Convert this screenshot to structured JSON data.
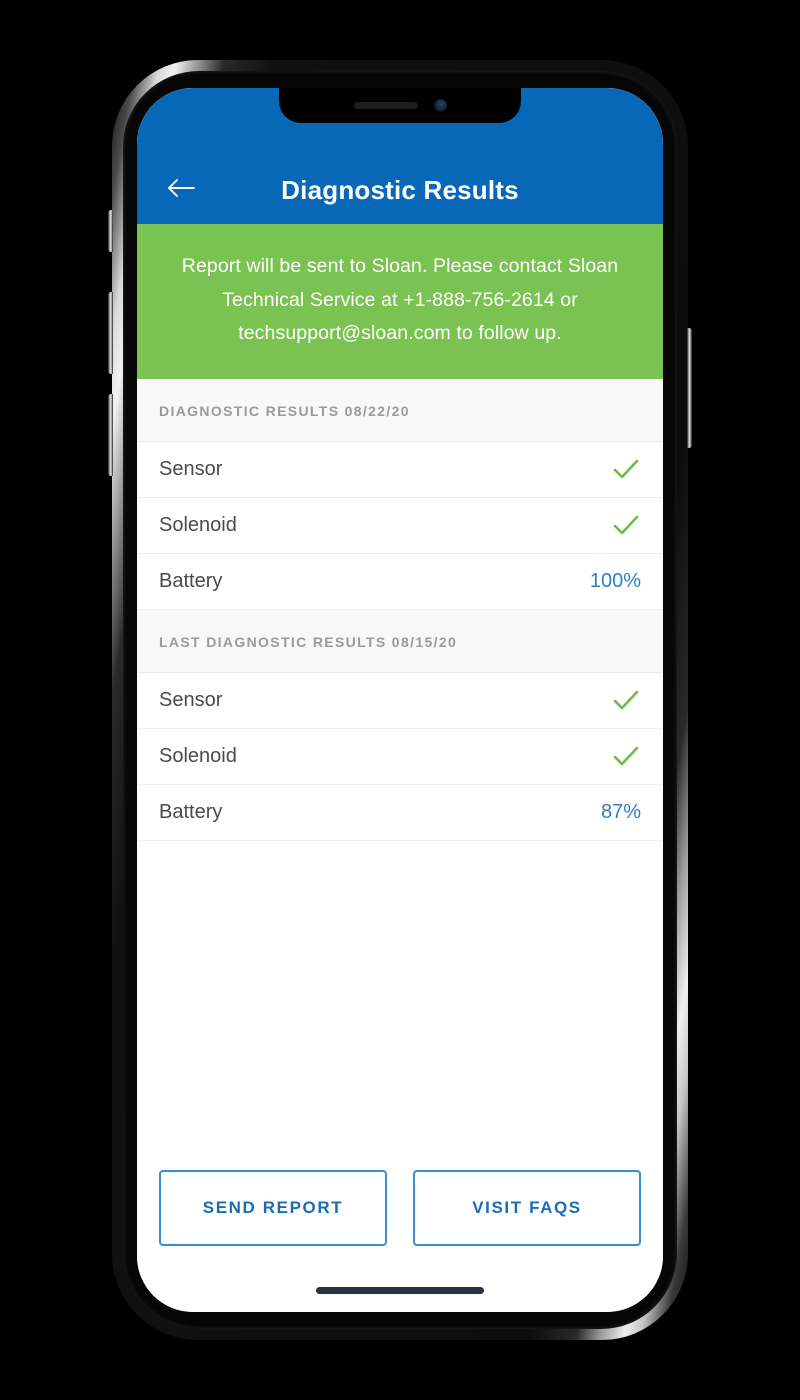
{
  "colors": {
    "brand_blue": "#0868b8",
    "banner_green": "#7ac352",
    "check_green": "#6cbe45",
    "value_blue": "#2e7fc4",
    "button_border": "#3b8fd0",
    "button_text": "#1a6cb5",
    "section_header_bg": "#f8f8f8",
    "section_header_text": "#9a9a9a",
    "row_text": "#4a4a4a"
  },
  "appbar": {
    "back_icon": "arrow-left-icon",
    "title": "Diagnostic Results"
  },
  "banner": {
    "text": "Report will be sent to Sloan. Please contact Sloan Technical Service at +1-888-756-2614 or techsupport@sloan.com to follow up."
  },
  "sections": [
    {
      "header": "DIAGNOSTIC RESULTS 08/22/20",
      "rows": [
        {
          "label": "Sensor",
          "value_type": "check",
          "value": ""
        },
        {
          "label": "Solenoid",
          "value_type": "check",
          "value": ""
        },
        {
          "label": "Battery",
          "value_type": "percent",
          "value": "100%"
        }
      ]
    },
    {
      "header": "LAST DIAGNOSTIC RESULTS 08/15/20",
      "rows": [
        {
          "label": "Sensor",
          "value_type": "check",
          "value": ""
        },
        {
          "label": "Solenoid",
          "value_type": "check",
          "value": ""
        },
        {
          "label": "Battery",
          "value_type": "percent",
          "value": "87%"
        }
      ]
    }
  ],
  "footer": {
    "send_report_label": "SEND REPORT",
    "visit_faqs_label": "VISIT FAQS"
  },
  "device": {
    "notch_speaker": "speaker-grille",
    "notch_camera": "front-camera",
    "home_indicator": "home-indicator"
  }
}
